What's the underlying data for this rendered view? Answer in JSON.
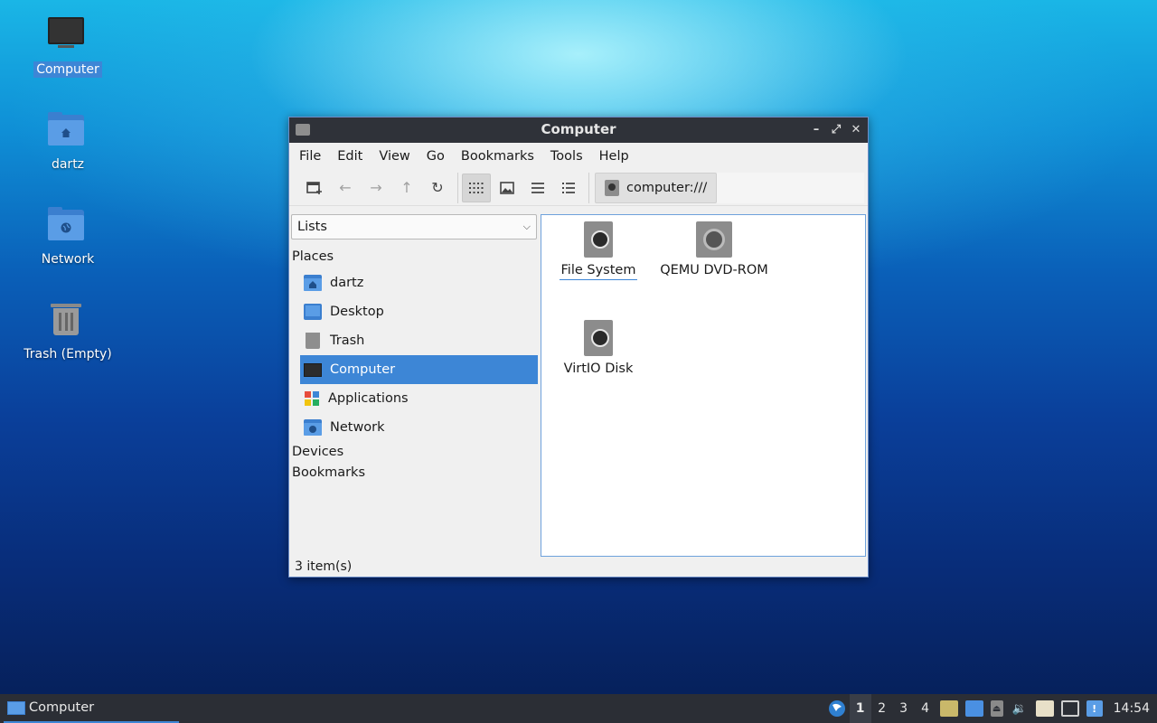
{
  "desktop": {
    "icons": [
      {
        "label": "Computer"
      },
      {
        "label": "dartz"
      },
      {
        "label": "Network"
      },
      {
        "label": "Trash (Empty)"
      }
    ]
  },
  "window": {
    "title": "Computer",
    "menu": [
      "File",
      "Edit",
      "View",
      "Go",
      "Bookmarks",
      "Tools",
      "Help"
    ],
    "location": "computer:///",
    "sidepane": {
      "combo_value": "Lists",
      "sections": {
        "places": "Places",
        "devices": "Devices",
        "bookmarks": "Bookmarks"
      },
      "places": [
        {
          "label": "dartz"
        },
        {
          "label": "Desktop"
        },
        {
          "label": "Trash"
        },
        {
          "label": "Computer"
        },
        {
          "label": "Applications"
        },
        {
          "label": "Network"
        }
      ]
    },
    "items": [
      {
        "label": "File System"
      },
      {
        "label": "QEMU DVD-ROM"
      },
      {
        "label": "VirtIO Disk"
      }
    ],
    "status": "3 item(s)"
  },
  "taskbar": {
    "task_label": "Computer",
    "workspaces": [
      "1",
      "2",
      "3",
      "4"
    ],
    "clock": "14:54"
  },
  "colors": {
    "selection": "#3d86d6",
    "titlebar": "#2f3239",
    "taskbar": "#2b2e35"
  }
}
